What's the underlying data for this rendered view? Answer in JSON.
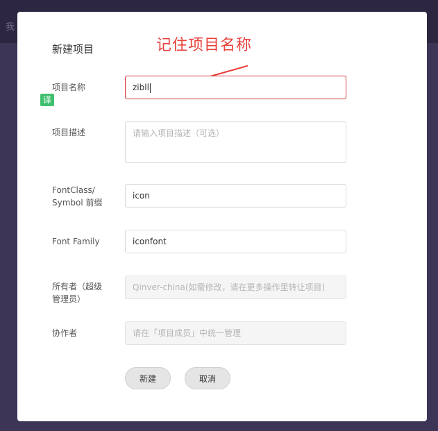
{
  "background": {
    "glyph": "我"
  },
  "modal": {
    "title": "新建项目",
    "annotation": "记住项目名称",
    "translate_badge": "译"
  },
  "form": {
    "name": {
      "label": "项目名称",
      "value": "zibll"
    },
    "description": {
      "label": "项目描述",
      "placeholder": "请输入项目描述（可选）"
    },
    "prefix": {
      "label_line1": "FontClass/",
      "label_line2": "Symbol 前缀",
      "value": "icon"
    },
    "font_family": {
      "label": "Font Family",
      "value": "iconfont"
    },
    "owner": {
      "label_line1": "所有者（超级",
      "label_line2": "管理员）",
      "value": "Qinver-china(如需修改，请在更多操作里转让项目)"
    },
    "collaborators": {
      "label": "协作者",
      "placeholder": "请在「项目成员」中统一管理"
    }
  },
  "buttons": {
    "create": "新建",
    "cancel": "取消"
  },
  "colors": {
    "accent_red": "#d8363a",
    "annotation_red": "#e8423c",
    "badge_green": "#3fbf6f"
  }
}
